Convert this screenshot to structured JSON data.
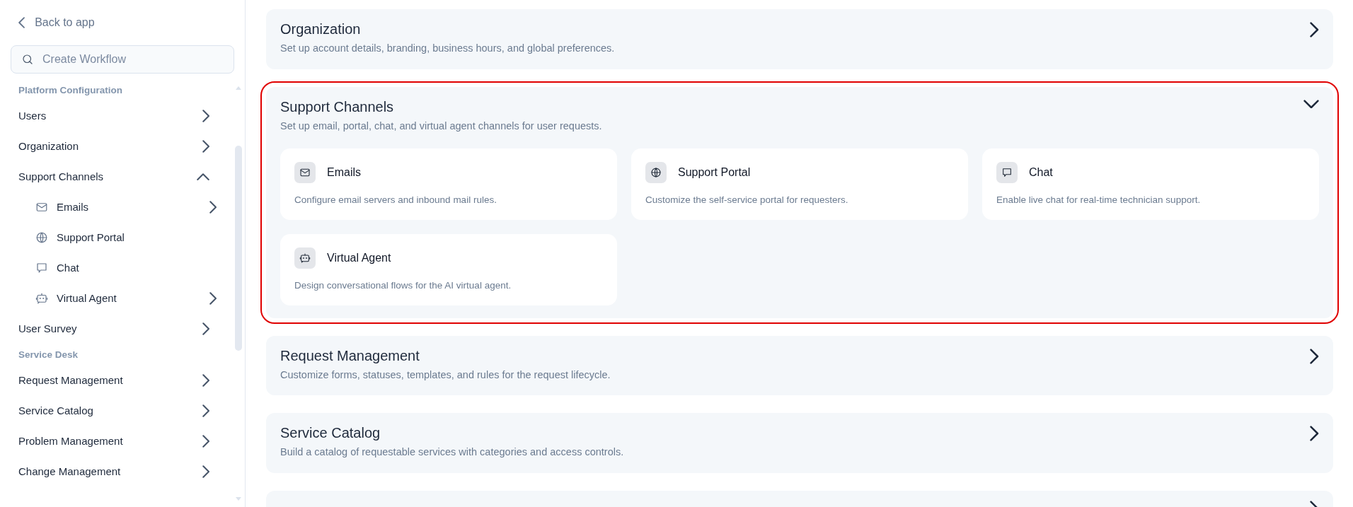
{
  "sidebar": {
    "back_link": "Back to app",
    "search": {
      "placeholder": "Create Workflow"
    },
    "groups": [
      {
        "title": "Platform Configuration",
        "items": [
          {
            "label": "Users",
            "expanded": false
          },
          {
            "label": "Organization",
            "expanded": false
          },
          {
            "label": "Support Channels",
            "expanded": true,
            "children": [
              {
                "label": "Emails",
                "kind": "mail",
                "expanded": false
              },
              {
                "label": "Support Portal",
                "kind": "globe"
              },
              {
                "label": "Chat",
                "kind": "chat"
              },
              {
                "label": "Virtual Agent",
                "kind": "bot",
                "expanded": false
              }
            ]
          },
          {
            "label": "User Survey",
            "expanded": false
          }
        ]
      },
      {
        "title": "Service Desk",
        "items": [
          {
            "label": "Request Management",
            "expanded": false
          },
          {
            "label": "Service Catalog",
            "expanded": false
          },
          {
            "label": "Problem Management",
            "expanded": false
          },
          {
            "label": "Change Management",
            "expanded": false
          }
        ]
      }
    ]
  },
  "sections": [
    {
      "title": "Organization",
      "description": "Set up account details, branding, business hours, and global preferences.",
      "expanded": false,
      "highlighted": false
    },
    {
      "title": "Support Channels",
      "description": "Set up email, portal, chat, and virtual agent channels for user requests.",
      "expanded": true,
      "highlighted": true,
      "cards": [
        {
          "kind": "mail",
          "title": "Emails",
          "description": "Configure email servers and inbound mail rules."
        },
        {
          "kind": "globe",
          "title": "Support Portal",
          "description": "Customize the self-service portal for requesters."
        },
        {
          "kind": "chat",
          "title": "Chat",
          "description": "Enable live chat for real-time technician support."
        },
        {
          "kind": "bot",
          "title": "Virtual Agent",
          "description": "Design conversational flows for the AI virtual agent."
        }
      ]
    },
    {
      "title": "Request Management",
      "description": "Customize forms, statuses, templates, and rules for the request lifecycle.",
      "expanded": false,
      "highlighted": false
    },
    {
      "title": "Service Catalog",
      "description": "Build a catalog of requestable services with categories and access controls.",
      "expanded": false,
      "highlighted": false
    },
    {
      "expanded": false
    }
  ]
}
